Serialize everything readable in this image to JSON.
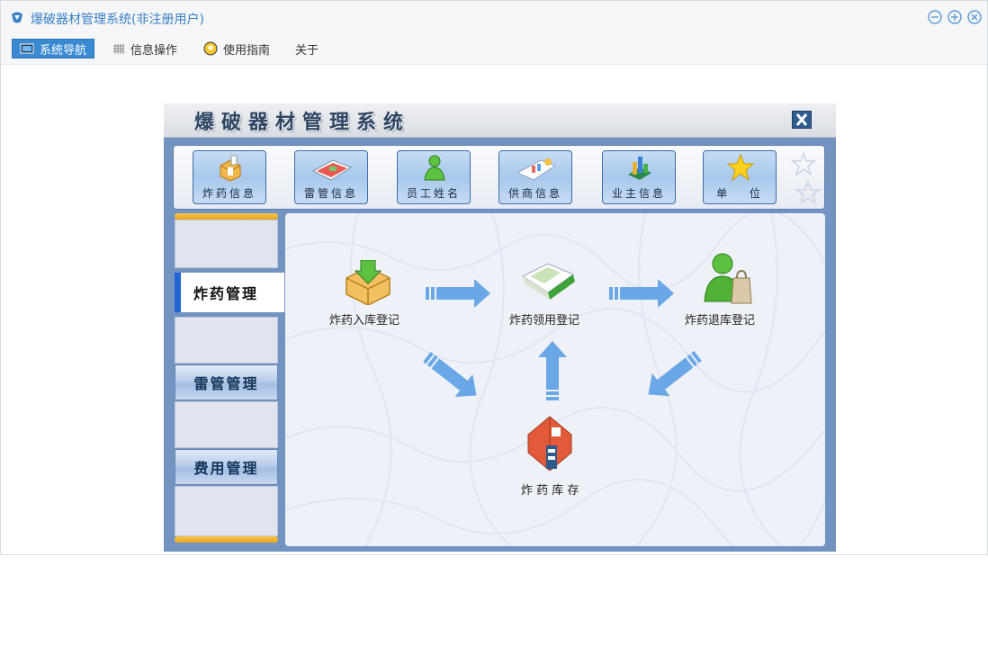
{
  "window": {
    "title": "爆破器材管理系统(非注册用户)",
    "menu": [
      {
        "label": "系统导航",
        "icon": "monitor-icon",
        "active": true
      },
      {
        "label": "信息操作",
        "icon": "grid-icon",
        "active": false
      },
      {
        "label": "使用指南",
        "icon": "bulb-icon",
        "active": false
      },
      {
        "label": "关于",
        "icon": "",
        "active": false
      }
    ]
  },
  "app": {
    "title": "爆破器材管理系统",
    "toolbar": [
      {
        "label": "炸药信息",
        "icon": "explosive-box-icon"
      },
      {
        "label": "雷管信息",
        "icon": "detonator-icon"
      },
      {
        "label": "员工姓名",
        "icon": "employee-icon"
      },
      {
        "label": "供商信息",
        "icon": "supplier-icon"
      },
      {
        "label": "业主信息",
        "icon": "owner-chart-icon"
      },
      {
        "label": "单　 位",
        "icon": "star-icon"
      }
    ],
    "nav": {
      "active": "炸药管理",
      "items": [
        "雷管管理",
        "费用管理"
      ]
    },
    "flow": {
      "stock_in": "炸药入库登记",
      "use": "炸药领用登记",
      "return": "炸药退库登记",
      "inventory": "炸 药 库 存"
    }
  },
  "colors": {
    "accent": "#3a8ad2",
    "frame": "#7393c1",
    "arrow": "#6aa7e6"
  }
}
